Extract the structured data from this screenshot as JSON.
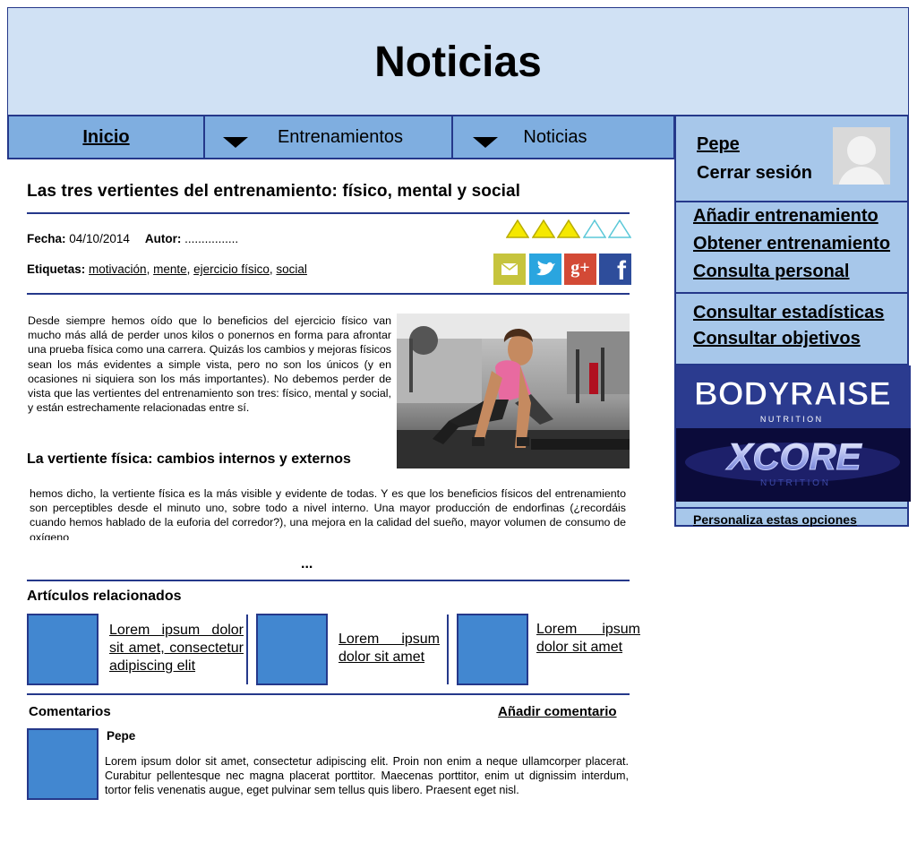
{
  "header": {
    "title": "Noticias"
  },
  "nav": {
    "items": [
      {
        "label": "Inicio"
      },
      {
        "label": "Entrenamientos"
      },
      {
        "label": "Noticias"
      }
    ]
  },
  "user": {
    "name": "Pepe",
    "logout": "Cerrar sesión"
  },
  "sidebar": {
    "group1": [
      "Añadir entrenamiento",
      "Obtener entrenamiento",
      "Consulta personal"
    ],
    "group2": [
      "Consultar estadísticas",
      "Consultar objetivos"
    ],
    "brands": [
      {
        "name": "BODYRAISE",
        "sub": "N U T R I T I O N"
      },
      {
        "name": "XCORE",
        "sub": "N U T R I T I O N"
      }
    ],
    "customize": "Personaliza estas opciones"
  },
  "article": {
    "title": "Las tres vertientes del entrenamiento: físico, mental y social",
    "date_label": "Fecha:",
    "date": "04/10/2014",
    "author_label": "Autor:",
    "author": "................",
    "tags_label": "Etiquetas:",
    "tags": [
      "motivación",
      "mente",
      "ejercicio físico",
      "social"
    ],
    "rating": {
      "value": 3,
      "max": 5
    },
    "social": [
      "email-icon",
      "twitter-icon",
      "google-plus-icon",
      "facebook-icon"
    ],
    "intro": "Desde siempre hemos oído que lo beneficios del ejercicio físico van mucho más allá de perder unos kilos o ponernos en forma para afrontar una prueba física como una carrera. Quizás los cambios y mejoras físicos sean los más evidentes a simple vista, pero no son los únicos (y en ocasiones ni siquiera son los más importantes). No debemos perder de vista que las vertientes del entrenamiento son tres: físico, mental y social, y están estrechamente relacionadas entre sí.",
    "subtitle": "La vertiente física: cambios internos y externos",
    "body": " hemos dicho, la vertiente física es la más visible y evidente de todas. Y es que los beneficios físicos del entrenamiento son perceptibles desde el minuto uno, sobre todo a nivel interno. Una mayor producción de endorfinas (¿recordáis cuando hemos hablado de la euforia del corredor?), una mejora en la calidad del sueño, mayor volumen de consumo de oxígeno",
    "more": "..."
  },
  "related": {
    "title": "Artículos relacionados",
    "items": [
      {
        "text": "  Lorem ipsum dolor sit amet, consectetur adipiscing elit"
      },
      {
        "text": "  Lorem ipsum dolor sit amet"
      },
      {
        "text": "  Lorem ipsum dolor sit amet"
      }
    ]
  },
  "comments": {
    "title": "Comentarios",
    "add": "Añadir comentario",
    "items": [
      {
        "author": "Pepe",
        "text": " Lorem ipsum dolor sit amet, consectetur adipiscing elit. Proin non enim a neque ullamcorper placerat. Curabitur pellentesque nec magna placerat porttitor. Maecenas porttitor, enim ut dignissim interdum, tortor felis venenatis augue, eget pulvinar sem tellus quis libero. Praesent eget nisl."
      }
    ]
  },
  "colors": {
    "header_bg": "#d0e1f4",
    "nav_bg": "#7faee0",
    "sidebar_bg": "#a7c7ea",
    "border": "#25388a",
    "thumb": "#4287d0",
    "star_filled": "#f5e800",
    "star_empty": "#5bc8d8"
  }
}
